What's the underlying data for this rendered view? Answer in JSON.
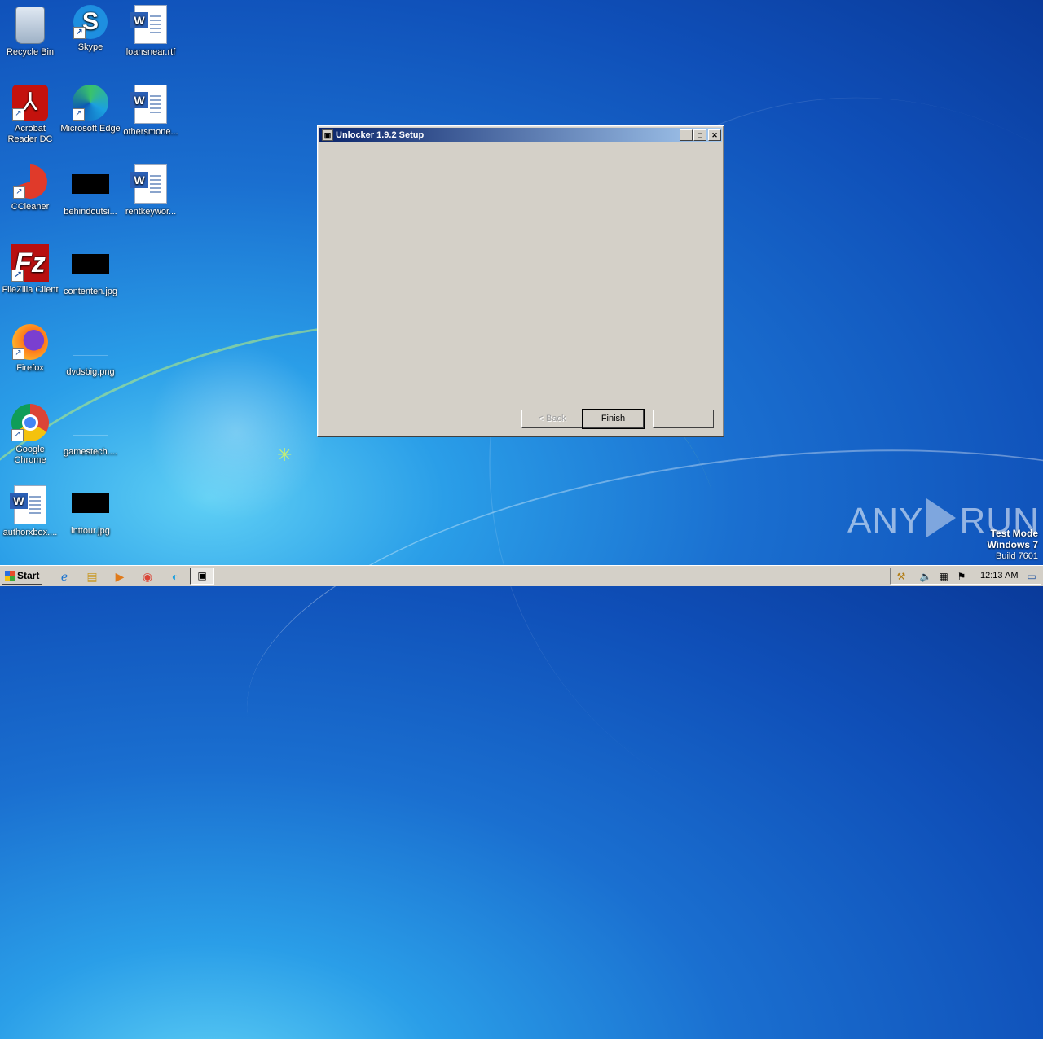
{
  "desktop": {
    "icons": [
      {
        "label": "Recycle Bin"
      },
      {
        "label": "Skype"
      },
      {
        "label": "loansnear.rtf"
      },
      {
        "label": "Acrobat Reader DC"
      },
      {
        "label": "Microsoft Edge"
      },
      {
        "label": "othersmone..."
      },
      {
        "label": "CCleaner"
      },
      {
        "label": "behindoutsi..."
      },
      {
        "label": "rentkeywor..."
      },
      {
        "label": "FileZilla Client"
      },
      {
        "label": "contenten.jpg"
      },
      {
        "label": "Firefox"
      },
      {
        "label": "dvdsbig.png"
      },
      {
        "label": "Google Chrome"
      },
      {
        "label": "gamestech...."
      },
      {
        "label": "authorxbox...."
      },
      {
        "label": "inttour.jpg"
      }
    ]
  },
  "window": {
    "title": "Unlocker 1.9.2 Setup",
    "controls": {
      "minimize": "_",
      "maximize": "□",
      "close": "✕"
    },
    "buttons": {
      "back": "< Back",
      "finish": "Finish",
      "cancel": ""
    }
  },
  "watermark": {
    "brand_left": "ANY",
    "brand_right": "RUN",
    "test_mode": "Test Mode",
    "os": "Windows 7",
    "build": "Build 7601"
  },
  "taskbar": {
    "start_label": "Start",
    "clock": "12:13 AM",
    "pinned": [
      "internet-explorer-icon",
      "explorer-icon",
      "media-player-icon",
      "chrome-icon",
      "edge-icon"
    ],
    "active_task": "unlocker-setup-icon"
  }
}
